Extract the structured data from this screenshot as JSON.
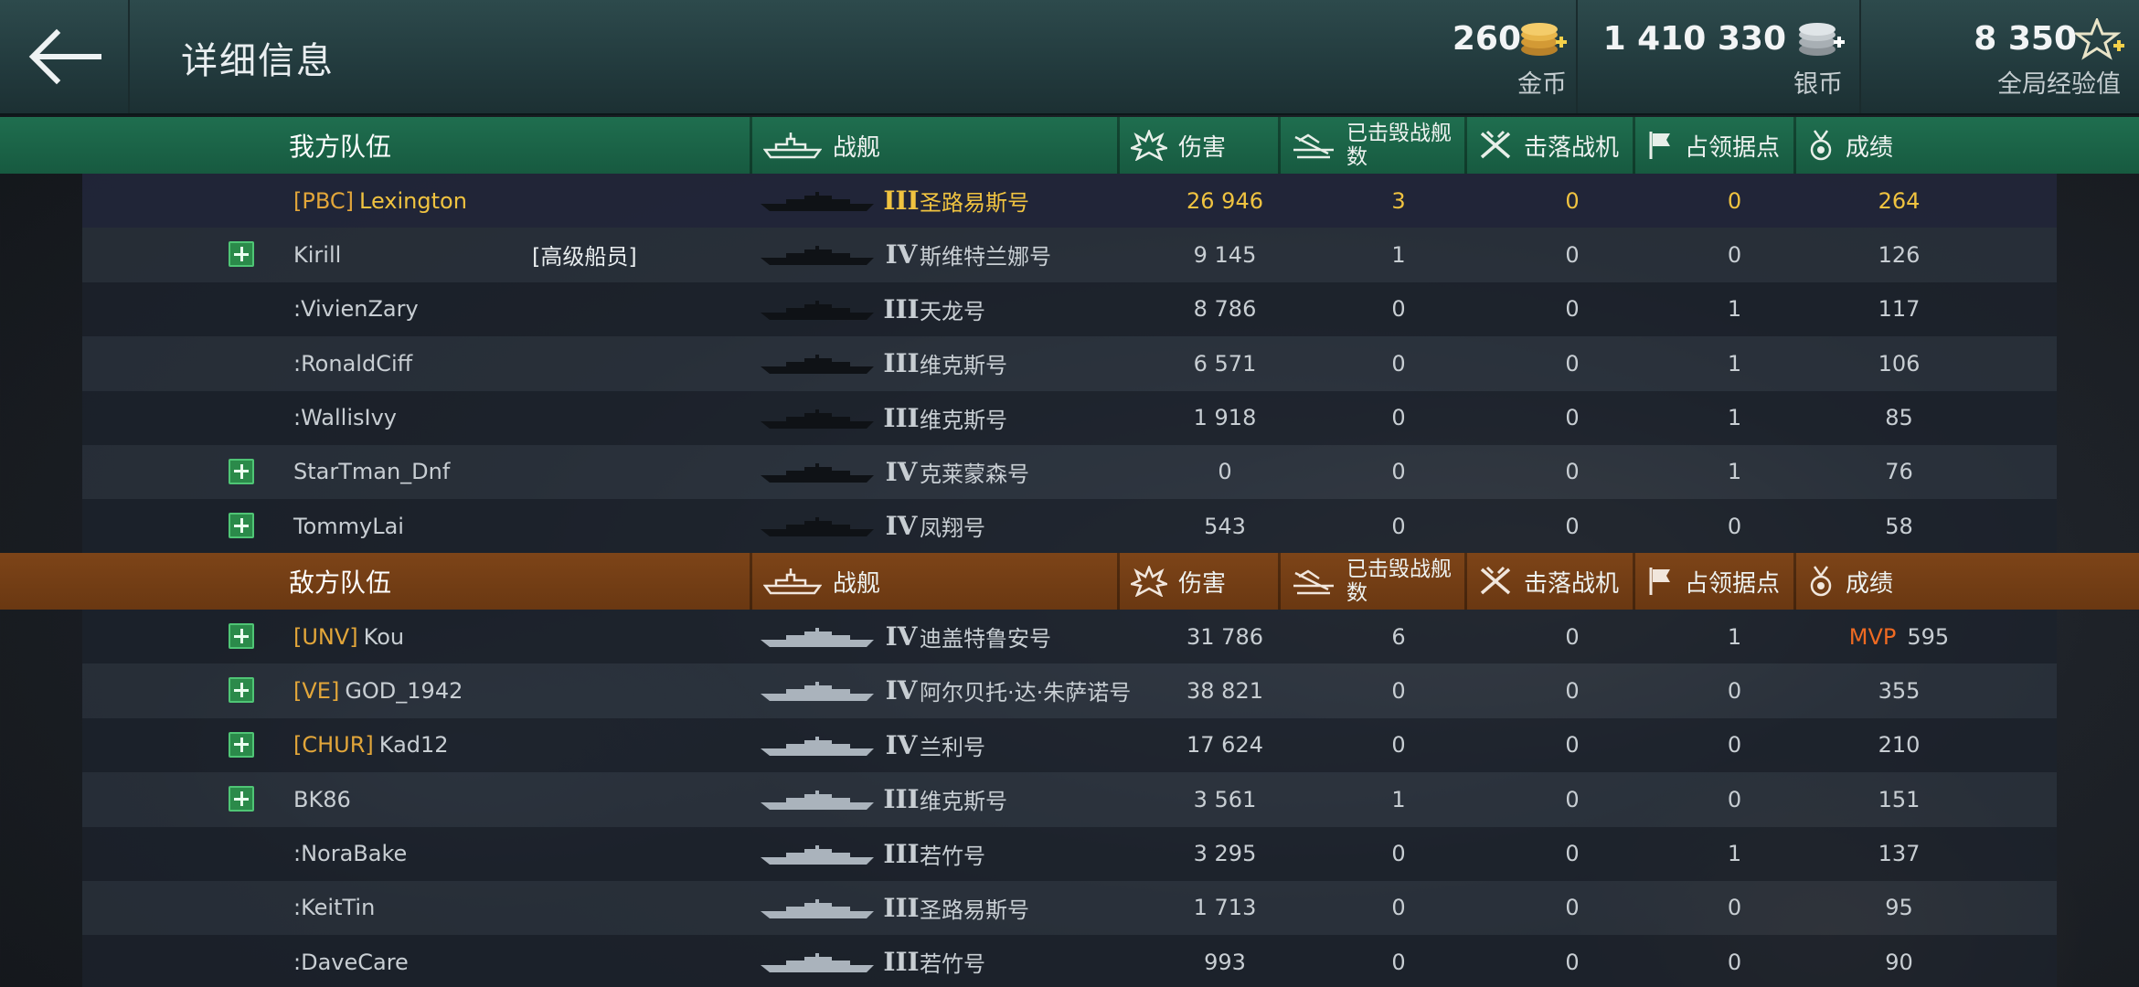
{
  "header": {
    "title": "详细信息",
    "gold": {
      "value": "260",
      "label": "金币"
    },
    "silver": {
      "value": "1 410 330",
      "label": "银币"
    },
    "xp": {
      "value": "8 350",
      "label": "全局经验值"
    }
  },
  "columns": {
    "ship": "战舰",
    "damage": "伤害",
    "kills_line1": "已击毁战舰",
    "kills_line2": "数",
    "planes": "击落战机",
    "capture": "占领据点",
    "score": "成绩"
  },
  "ally": {
    "team_name": "我方队伍",
    "players": [
      {
        "plus": false,
        "clan": "[PBC]",
        "name": "Lexington",
        "rank": "",
        "tier": "III",
        "ship": "圣路易斯号",
        "damage": "26 946",
        "kills": "3",
        "planes": "0",
        "capture": "0",
        "mvp": "",
        "score": "264",
        "highlight": true
      },
      {
        "plus": true,
        "clan": "",
        "name": "Kirill",
        "rank": "[高级船员]",
        "tier": "IV",
        "ship": "斯维特兰娜号",
        "damage": "9 145",
        "kills": "1",
        "planes": "0",
        "capture": "0",
        "mvp": "",
        "score": "126"
      },
      {
        "plus": false,
        "clan": "",
        "name": ":VivienZary",
        "rank": "",
        "tier": "III",
        "ship": "天龙号",
        "damage": "8 786",
        "kills": "0",
        "planes": "0",
        "capture": "1",
        "mvp": "",
        "score": "117"
      },
      {
        "plus": false,
        "clan": "",
        "name": ":RonaldCiff",
        "rank": "",
        "tier": "III",
        "ship": "维克斯号",
        "damage": "6 571",
        "kills": "0",
        "planes": "0",
        "capture": "1",
        "mvp": "",
        "score": "106"
      },
      {
        "plus": false,
        "clan": "",
        "name": ":WallisIvy",
        "rank": "",
        "tier": "III",
        "ship": "维克斯号",
        "damage": "1 918",
        "kills": "0",
        "planes": "0",
        "capture": "1",
        "mvp": "",
        "score": "85"
      },
      {
        "plus": true,
        "clan": "",
        "name": "StarTman_Dnf",
        "rank": "",
        "tier": "IV",
        "ship": "克莱蒙森号",
        "damage": "0",
        "kills": "0",
        "planes": "0",
        "capture": "1",
        "mvp": "",
        "score": "76"
      },
      {
        "plus": true,
        "clan": "",
        "name": "TommyLai",
        "rank": "",
        "tier": "IV",
        "ship": "凤翔号",
        "damage": "543",
        "kills": "0",
        "planes": "0",
        "capture": "0",
        "mvp": "",
        "score": "58"
      }
    ]
  },
  "enemy": {
    "team_name": "敌方队伍",
    "players": [
      {
        "plus": true,
        "clan": "[UNV]",
        "name": "Kou",
        "rank": "",
        "tier": "IV",
        "ship": "迪盖特鲁安号",
        "damage": "31 786",
        "kills": "6",
        "planes": "0",
        "capture": "1",
        "mvp": "MVP",
        "score": "595"
      },
      {
        "plus": true,
        "clan": "[VE]",
        "name": "GOD_1942",
        "rank": "",
        "tier": "IV",
        "ship": "阿尔贝托·达·朱萨诺号",
        "damage": "38 821",
        "kills": "0",
        "planes": "0",
        "capture": "0",
        "mvp": "",
        "score": "355"
      },
      {
        "plus": true,
        "clan": "[CHUR]",
        "name": "Kad12",
        "rank": "",
        "tier": "IV",
        "ship": "兰利号",
        "damage": "17 624",
        "kills": "0",
        "planes": "0",
        "capture": "0",
        "mvp": "",
        "score": "210"
      },
      {
        "plus": true,
        "clan": "",
        "name": "BK86",
        "rank": "",
        "tier": "III",
        "ship": "维克斯号",
        "damage": "3 561",
        "kills": "1",
        "planes": "0",
        "capture": "0",
        "mvp": "",
        "score": "151"
      },
      {
        "plus": false,
        "clan": "",
        "name": ":NoraBake",
        "rank": "",
        "tier": "III",
        "ship": "若竹号",
        "damage": "3 295",
        "kills": "0",
        "planes": "0",
        "capture": "1",
        "mvp": "",
        "score": "137"
      },
      {
        "plus": false,
        "clan": "",
        "name": ":KeitTin",
        "rank": "",
        "tier": "III",
        "ship": "圣路易斯号",
        "damage": "1 713",
        "kills": "0",
        "planes": "0",
        "capture": "0",
        "mvp": "",
        "score": "95"
      },
      {
        "plus": false,
        "clan": "",
        "name": ":DaveCare",
        "rank": "",
        "tier": "III",
        "ship": "若竹号",
        "damage": "993",
        "kills": "0",
        "planes": "0",
        "capture": "0",
        "mvp": "",
        "score": "90"
      }
    ]
  },
  "colors": {
    "ally_header": "#1f6e4f",
    "enemy_header": "#7d4418",
    "highlight_text": "#f0c340",
    "clan_tag": "#e2a63a",
    "mvp": "#ef6a22",
    "plus_button": "#2b8a4a"
  },
  "icons": {
    "back": "arrow-left-icon",
    "gold": "gold-coins-plus-icon",
    "silver": "silver-coins-plus-icon",
    "xp": "star-plus-icon",
    "ship": "warship-icon",
    "damage": "explosion-icon",
    "kills": "sinking-ship-icon",
    "planes": "crossed-plane-icon",
    "capture": "flag-icon",
    "score": "medal-icon"
  }
}
